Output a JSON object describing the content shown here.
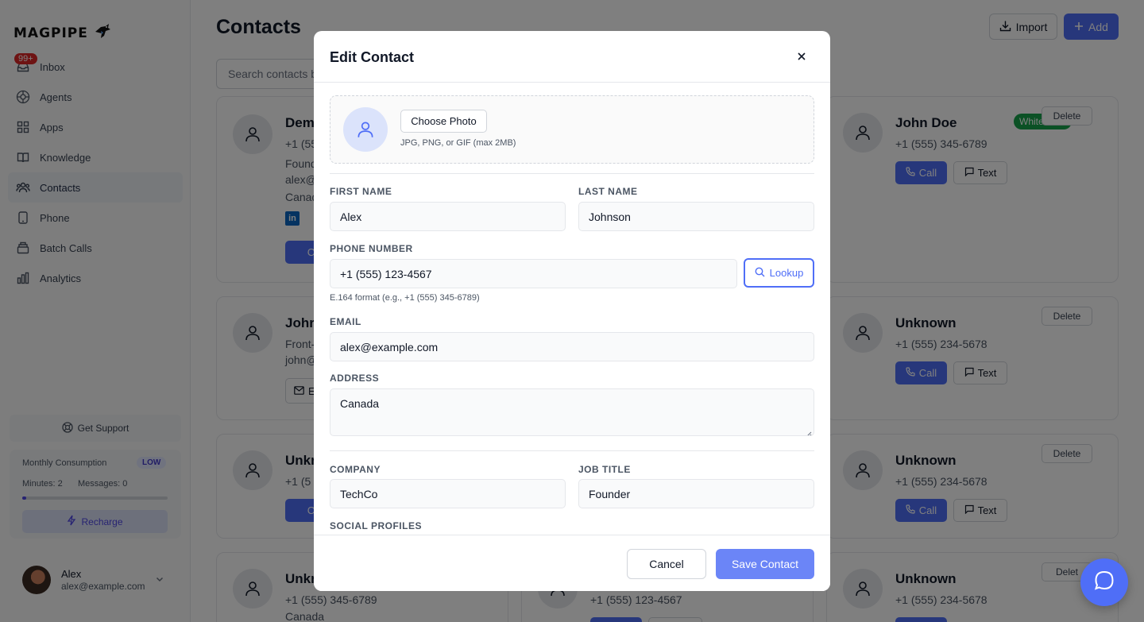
{
  "app": {
    "logo_text": "MAGPIPE"
  },
  "sidebar": {
    "inbox_badge": "99+",
    "items": [
      {
        "label": "Inbox",
        "icon": "inbox-icon"
      },
      {
        "label": "Agents",
        "icon": "agents-icon"
      },
      {
        "label": "Apps",
        "icon": "apps-icon"
      },
      {
        "label": "Knowledge",
        "icon": "book-icon"
      },
      {
        "label": "Contacts",
        "icon": "users-icon",
        "active": true
      },
      {
        "label": "Phone",
        "icon": "phone-icon"
      },
      {
        "label": "Batch Calls",
        "icon": "layers-icon"
      },
      {
        "label": "Analytics",
        "icon": "bar-chart-icon"
      }
    ],
    "support_label": "Get Support",
    "usage": {
      "title": "Monthly Consumption",
      "level": "LOW",
      "minutes": "Minutes: 2",
      "messages": "Messages: 0",
      "progress": 0.03,
      "recharge_label": "Recharge"
    },
    "user": {
      "name": "Alex",
      "email": "alex@example.com"
    }
  },
  "header": {
    "title": "Contacts",
    "import_label": "Import",
    "add_label": "Add",
    "search_placeholder": "Search contacts b"
  },
  "cards": [
    {
      "name": "Dem",
      "phone": "+1 (555",
      "line1": "Found",
      "line2": "alex@",
      "line3": "Canad",
      "call_label": "C"
    },
    {
      "name": "John Doe",
      "tag": "Whitelisted",
      "phone": "+1 (555) 345-6789",
      "delete_label": "Delete",
      "call_label": "Call",
      "text_label": "Text"
    },
    {
      "name": "Johr",
      "line1": "Front-",
      "line2": "john@",
      "email_label": "E"
    },
    {
      "name": "Unknown",
      "phone": "+1 (555) 234-5678",
      "delete_label": "Delete",
      "call_label": "Call",
      "text_label": "Text"
    },
    {
      "name": "Unkr",
      "phone": "+1 (5",
      "call_label": "C"
    },
    {
      "name": "Unknown",
      "phone": "+1 (555) 234-5678",
      "delete_label": "Delete",
      "call_label": "Call",
      "text_label": "Text"
    },
    {
      "name": "Unkr",
      "phone": "+1 (555) 345-6789",
      "line1": "Canada"
    },
    {
      "phone": "+1 (555) 123-4567"
    },
    {
      "name": "Unknown",
      "phone": "+1 (555) 234-5678",
      "delete_label": "Delet"
    }
  ],
  "modal": {
    "title": "Edit Contact",
    "choose_photo_label": "Choose Photo",
    "photo_hint": "JPG, PNG, or GIF (max 2MB)",
    "first_name_label": "FIRST NAME",
    "first_name": "Alex",
    "last_name_label": "LAST NAME",
    "last_name": "Johnson",
    "phone_label": "PHONE NUMBER",
    "phone": "+1 (555) 123-4567",
    "lookup_label": "Lookup",
    "phone_hint": "E.164 format (e.g., +1 (555) 345-6789)",
    "email_label": "EMAIL",
    "email": "alex@example.com",
    "address_label": "ADDRESS",
    "address": "Canada",
    "company_label": "COMPANY",
    "company": "TechCo",
    "job_title_label": "JOB TITLE",
    "job_title": "Founder",
    "social_label": "SOCIAL PROFILES",
    "cancel_label": "Cancel",
    "save_label": "Save Contact"
  },
  "colors": {
    "accent": "#4f6ef7",
    "whitelisted": "#16a34a",
    "badge": "#dc2626"
  }
}
